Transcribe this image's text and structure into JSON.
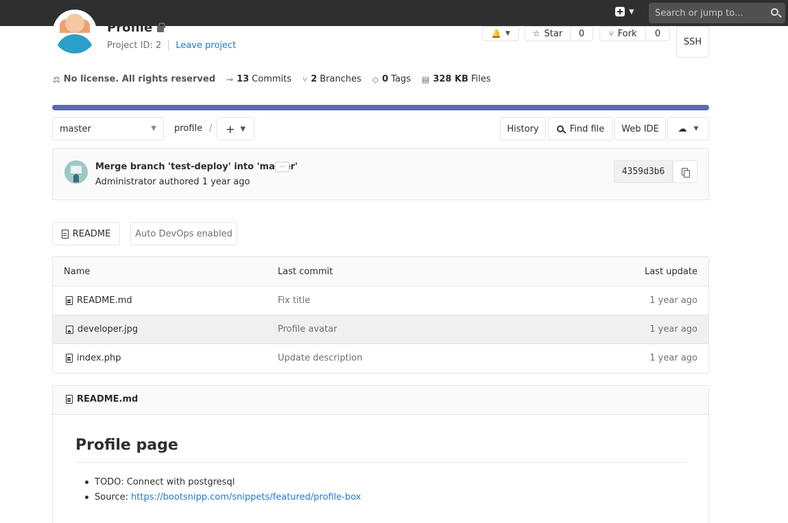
{
  "topbar": {
    "search_placeholder": "Search or jump to…"
  },
  "project": {
    "title": "Profile",
    "id_text": "Project ID: 2",
    "leave_label": "Leave project",
    "star_label": "Star",
    "star_count": "0",
    "fork_label": "Fork",
    "fork_count": "0",
    "ssh_label": "SSH"
  },
  "stats": {
    "license": "No license. All rights reserved",
    "commits_count": "13",
    "commits_label": "Commits",
    "branches_count": "2",
    "branches_label": "Branches",
    "tags_count": "0",
    "tags_label": "Tags",
    "files_size": "328 KB",
    "files_label": "Files"
  },
  "repo": {
    "branch": "master",
    "breadcrumb": "profile",
    "separator": "/",
    "history_label": "History",
    "find_file_label": "Find file",
    "web_ide_label": "Web IDE"
  },
  "commit": {
    "title": "Merge branch 'test-deploy' into 'master'",
    "ellipsis": "···",
    "author_line": "Administrator authored 1 year ago",
    "sha": "4359d3b6"
  },
  "actions": {
    "readme_label": "README",
    "autodevops_label": "Auto DevOps enabled"
  },
  "files": {
    "headers": [
      "Name",
      "Last commit",
      "Last update"
    ],
    "rows": [
      {
        "name": "README.md",
        "commit": "Fix title",
        "updated": "1 year ago",
        "icon": "file-icon"
      },
      {
        "name": "developer.jpg",
        "commit": "Profile avatar",
        "updated": "1 year ago",
        "icon": "image-file-icon"
      },
      {
        "name": "index.php",
        "commit": "Update description",
        "updated": "1 year ago",
        "icon": "file-icon"
      }
    ]
  },
  "readme": {
    "filename": "README.md",
    "heading": "Profile page",
    "item1": "TODO: Connect with postgresql",
    "item2_prefix": "Source:",
    "item2_link": "https://bootsnipp.com/snippets/featured/profile-box"
  },
  "colors": {
    "topbar": "#2f2f2f",
    "language_bar": "#5c6bac",
    "link": "#1f78d1"
  }
}
